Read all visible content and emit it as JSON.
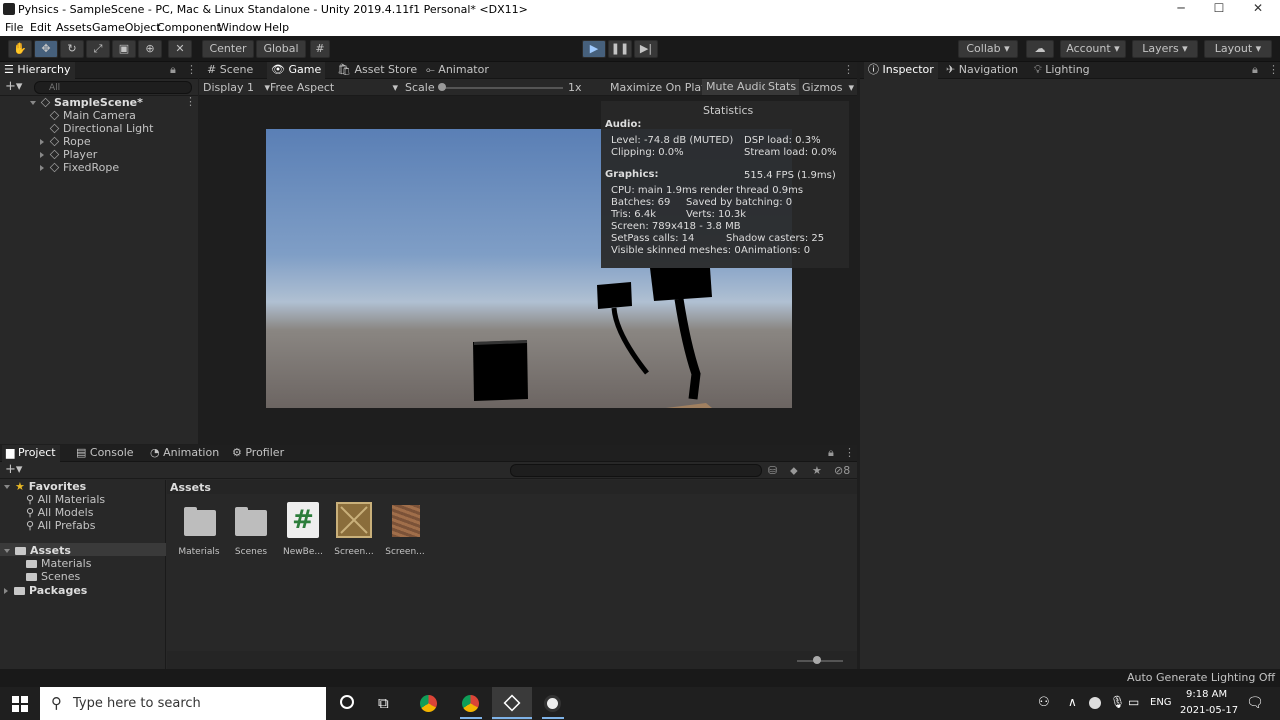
{
  "window": {
    "title": "Pyhsics - SampleScene - PC, Mac & Linux Standalone - Unity 2019.4.11f1 Personal* <DX11>",
    "minimize": "─",
    "maximize": "☐",
    "close": "✕"
  },
  "menu": [
    "File",
    "Edit",
    "Assets",
    "GameObject",
    "Component",
    "Window",
    "Help"
  ],
  "toolbar": {
    "pivot": "Center",
    "space": "Global",
    "collab": "Collab",
    "account": "Account",
    "layers": "Layers",
    "layout": "Layout"
  },
  "hierarchy": {
    "tab": "Hierarchy",
    "search_placeholder": "All",
    "scene": "SampleScene*",
    "items": [
      "Main Camera",
      "Directional Light",
      "Rope",
      "Player",
      "FixedRope"
    ]
  },
  "center_tabs": [
    "Scene",
    "Game",
    "Asset Store",
    "Animator"
  ],
  "game_toolbar": {
    "display": "Display 1",
    "aspect": "Free Aspect",
    "scale_label": "Scale",
    "scale_value": "1x",
    "maximize": "Maximize On Play",
    "mute": "Mute Audio",
    "stats": "Stats",
    "gizmos": "Gizmos"
  },
  "stats": {
    "title": "Statistics",
    "audio_header": "Audio:",
    "level": "Level: -74.8 dB (MUTED)",
    "dsp": "DSP load: 0.3%",
    "clipping": "Clipping: 0.0%",
    "stream": "Stream load: 0.0%",
    "graphics_header": "Graphics:",
    "fps": "515.4 FPS (1.9ms)",
    "cpu": "CPU: main 1.9ms  render thread 0.9ms",
    "batches": "Batches: 69",
    "saved": "Saved by batching: 0",
    "tris": "Tris: 6.4k",
    "verts": "Verts: 10.3k",
    "screen": "Screen: 789x418 - 3.8 MB",
    "setpass": "SetPass calls: 14",
    "shadow": "Shadow casters: 25",
    "skinned": "Visible skinned meshes: 0",
    "animations": "Animations: 0"
  },
  "inspector_tabs": [
    "Inspector",
    "Navigation",
    "Lighting"
  ],
  "bottom_tabs": [
    "Project",
    "Console",
    "Animation",
    "Profiler"
  ],
  "project": {
    "favorites": "Favorites",
    "fav_items": [
      "All Materials",
      "All Models",
      "All Prefabs"
    ],
    "assets": "Assets",
    "asset_folders": [
      "Materials",
      "Scenes"
    ],
    "packages": "Packages",
    "breadcrumb": "Assets",
    "hidden_count": "8",
    "grid": [
      "Materials",
      "Scenes",
      "NewBe...",
      "Screen...",
      "Screen..."
    ]
  },
  "status": "Auto Generate Lighting Off",
  "taskbar": {
    "search": "Type here to search",
    "lang": "ENG",
    "time": "9:18 AM",
    "date": "2021-05-17"
  }
}
